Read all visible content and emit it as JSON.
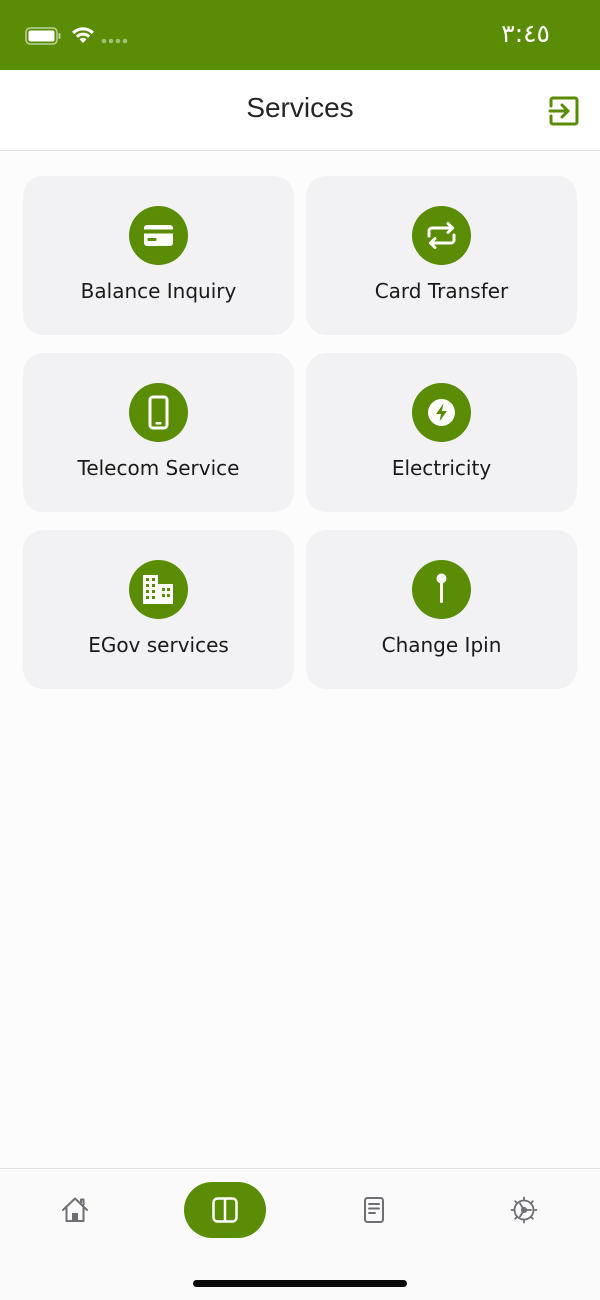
{
  "status_bar": {
    "time": "٣:٤٥",
    "background_color": "#5a8c05"
  },
  "header": {
    "title": "Services",
    "logout_icon": "logout-icon"
  },
  "services": [
    {
      "label": "Balance Inquiry",
      "icon": "credit-card-icon"
    },
    {
      "label": "Card Transfer",
      "icon": "transfer-arrows-icon"
    },
    {
      "label": "Telecom Service",
      "icon": "mobile-phone-icon"
    },
    {
      "label": "Electricity",
      "icon": "lightning-bolt-icon"
    },
    {
      "label": "EGov services",
      "icon": "building-icon"
    },
    {
      "label": "Change Ipin",
      "icon": "pin-icon"
    }
  ],
  "tab_bar": {
    "tabs": [
      {
        "icon": "home-icon",
        "active": false
      },
      {
        "icon": "services-grid-icon",
        "active": true
      },
      {
        "icon": "document-icon",
        "active": false
      },
      {
        "icon": "settings-icon",
        "active": false
      }
    ]
  },
  "colors": {
    "accent": "#5a8c05",
    "card_background": "#f2f2f4",
    "page_background": "#fdfcfd"
  }
}
